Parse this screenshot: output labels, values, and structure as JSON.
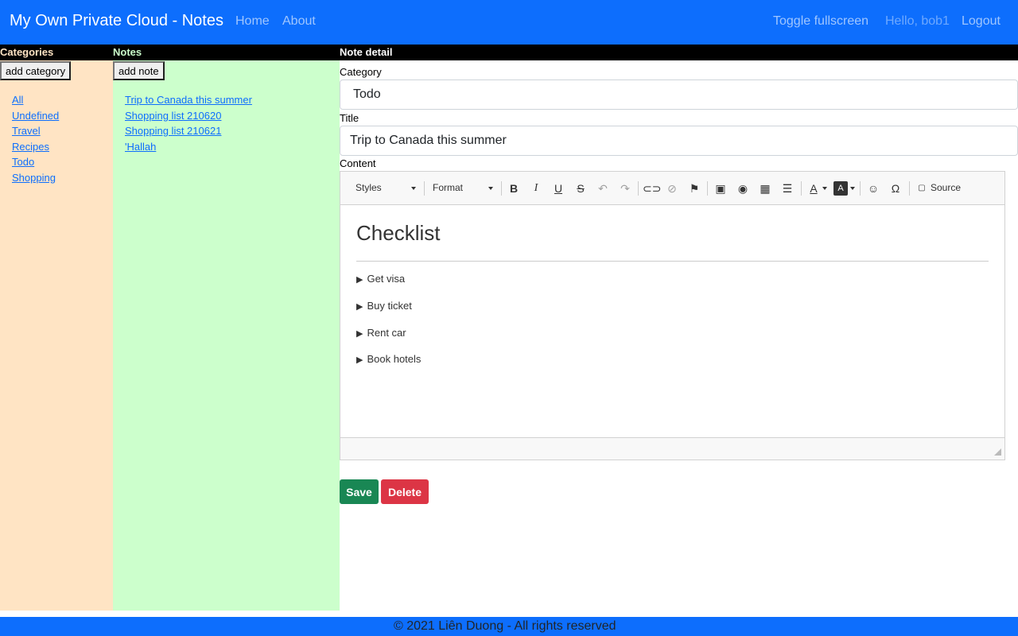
{
  "navbar": {
    "brand": "My Own Private Cloud - Notes",
    "links": [
      "Home",
      "About"
    ],
    "toggle_fullscreen": "Toggle fullscreen",
    "greeting": "Hello, bob1",
    "logout": "Logout"
  },
  "categories": {
    "header": "Categories",
    "add_button": "add category",
    "items": [
      "All",
      "Undefined",
      "Travel",
      "Recipes",
      "Todo",
      "Shopping"
    ]
  },
  "notes": {
    "header": "Notes",
    "add_button": "add note",
    "items": [
      "Trip to Canada this summer",
      "Shopping list 210620",
      "Shopping list 210621",
      "'Hallah"
    ]
  },
  "detail": {
    "header": "Note detail",
    "category_label": "Category",
    "category_value": "Todo",
    "title_label": "Title",
    "title_value": "Trip to Canada this summer",
    "content_label": "Content",
    "toolbar": {
      "styles": "Styles",
      "format": "Format",
      "source": "Source"
    },
    "content": {
      "heading": "Checklist",
      "items": [
        "Get visa",
        "Buy ticket",
        "Rent car",
        "Book hotels"
      ]
    },
    "save_label": "Save",
    "delete_label": "Delete"
  },
  "footer": {
    "text": "© 2021 Liên Duong - All rights reserved"
  },
  "colors": {
    "primary": "#0d6efd",
    "categories_bg": "#ffe4c4",
    "notes_bg": "#ccffcc",
    "save": "#198754",
    "delete": "#dc3545"
  }
}
